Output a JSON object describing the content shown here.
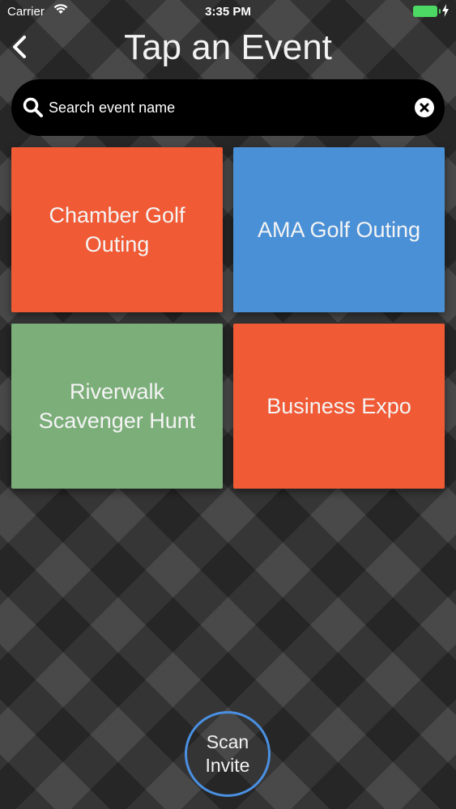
{
  "status_bar": {
    "carrier": "Carrier",
    "time": "3:35 PM",
    "wifi_icon": "wifi-icon",
    "battery_icon": "battery-icon",
    "charging_icon": "bolt-icon"
  },
  "nav": {
    "title": "Tap an Event",
    "back_icon": "chevron-left-icon"
  },
  "search": {
    "placeholder": "Search event name",
    "value": "",
    "search_icon": "search-icon",
    "clear_icon": "close-icon"
  },
  "events": [
    {
      "label": "Chamber Golf Outing",
      "color": "#f05a35"
    },
    {
      "label": "AMA Golf Outing",
      "color": "#4a90d6"
    },
    {
      "label": "Riverwalk Scavenger Hunt",
      "color": "#7cae7a"
    },
    {
      "label": "Business Expo",
      "color": "#f05a35"
    }
  ],
  "scan_button": {
    "label": "Scan Invite",
    "color": "#4a90e2"
  }
}
